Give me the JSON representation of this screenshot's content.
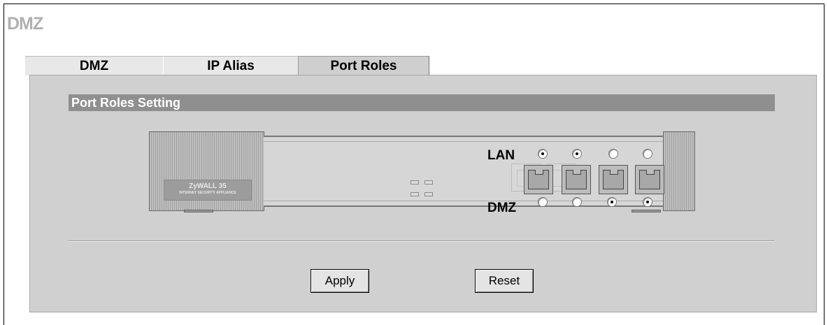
{
  "page": {
    "title": "DMZ"
  },
  "tabs": [
    {
      "label": "DMZ"
    },
    {
      "label": "IP Alias"
    },
    {
      "label": "Port Roles",
      "active": true
    }
  ],
  "section": {
    "header": "Port Roles Setting"
  },
  "device": {
    "logo_text": "ZyWALL 35",
    "logo_subtext": "INTERNET SECURITY APPLIANCE",
    "lan_label": "LAN",
    "dmz_label": "DMZ",
    "ports": [
      {
        "role": "LAN"
      },
      {
        "role": "LAN"
      },
      {
        "role": "DMZ"
      },
      {
        "role": "DMZ"
      }
    ]
  },
  "buttons": {
    "apply": "Apply",
    "reset": "Reset"
  },
  "colors": {
    "panel": "#d0d0d0",
    "section_header": "#8f8f8f",
    "title": "#b0b0b0"
  }
}
